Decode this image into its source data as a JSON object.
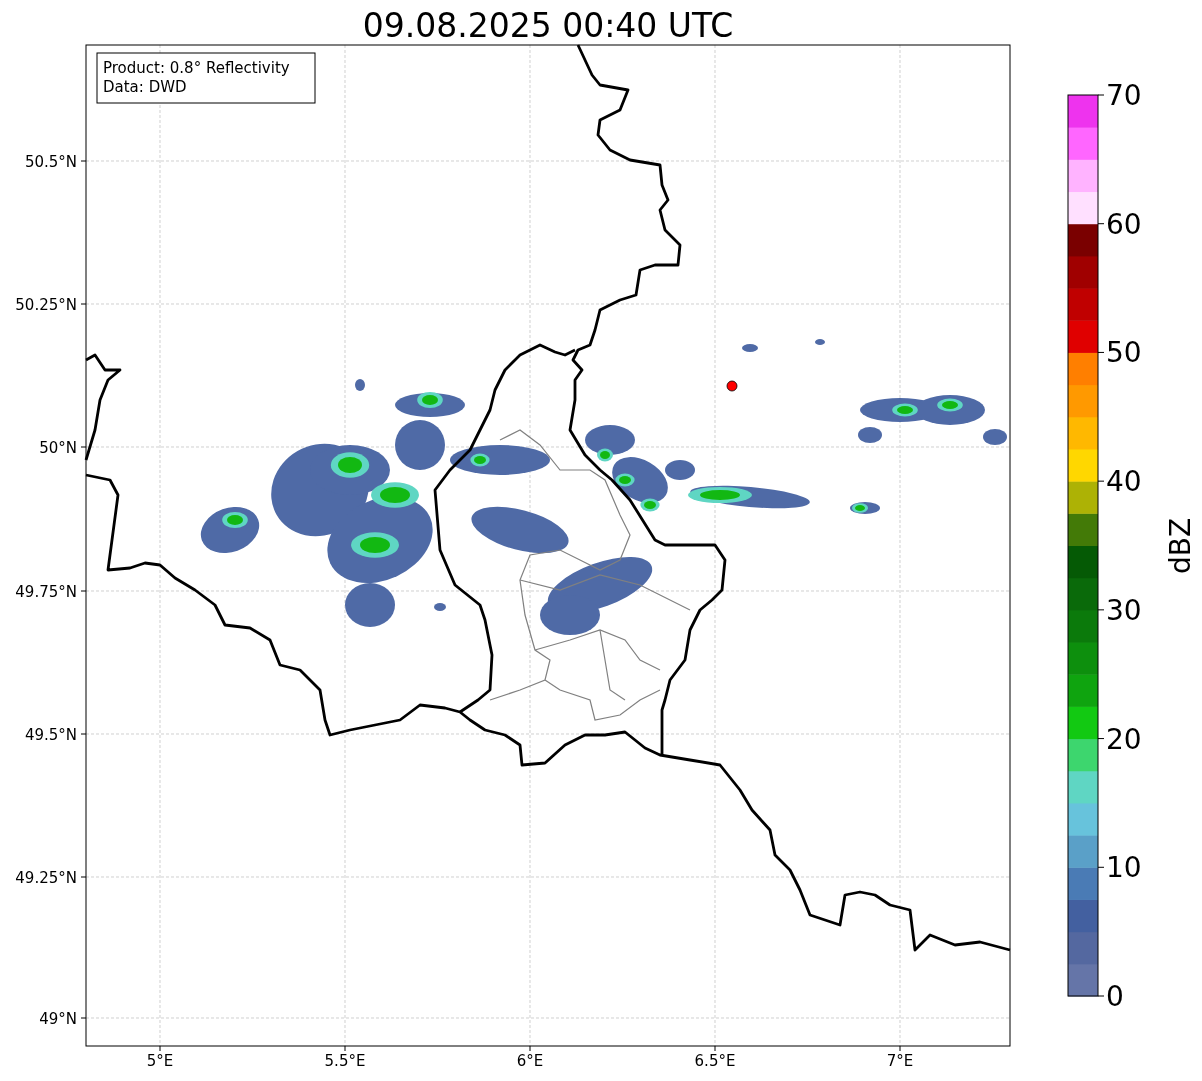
{
  "title": "09.08.2025 00:40 UTC",
  "info_box": [
    "Product: 0.8° Reflectivity",
    "Data: DWD"
  ],
  "map": {
    "lat_labels": [
      "50.5°N",
      "50.25°N",
      "50°N",
      "49.75°N",
      "49.5°N",
      "49.25°N",
      "49°N"
    ],
    "lon_labels": [
      "5°E",
      "5.5°E",
      "6°E",
      "6.5°E",
      "7°E"
    ]
  },
  "colorbar": {
    "label": "dBZ",
    "ticks": [
      "70",
      "60",
      "50",
      "40",
      "30",
      "20",
      "10",
      "0"
    ],
    "segments": [
      {
        "color": "#6575a8"
      },
      {
        "color": "#5468a0"
      },
      {
        "color": "#4360a0"
      },
      {
        "color": "#4a7bb5"
      },
      {
        "color": "#5aa0c8"
      },
      {
        "color": "#67c3dc"
      },
      {
        "color": "#5fd6c3"
      },
      {
        "color": "#3dd66e"
      },
      {
        "color": "#12c912"
      },
      {
        "color": "#0fa40f"
      },
      {
        "color": "#0d8f0d"
      },
      {
        "color": "#0b7a0b"
      },
      {
        "color": "#0a6a0a"
      },
      {
        "color": "#055a05"
      },
      {
        "color": "#437a07"
      },
      {
        "color": "#adb205"
      },
      {
        "color": "#ffd700"
      },
      {
        "color": "#ffb800"
      },
      {
        "color": "#ff9900"
      },
      {
        "color": "#ff7f00"
      },
      {
        "color": "#e00000"
      },
      {
        "color": "#c00000"
      },
      {
        "color": "#a00000"
      },
      {
        "color": "#7a0000"
      },
      {
        "color": "#ffe0ff"
      },
      {
        "color": "#ffb3ff"
      },
      {
        "color": "#ff66ff"
      },
      {
        "color": "#ee33ee"
      }
    ]
  }
}
